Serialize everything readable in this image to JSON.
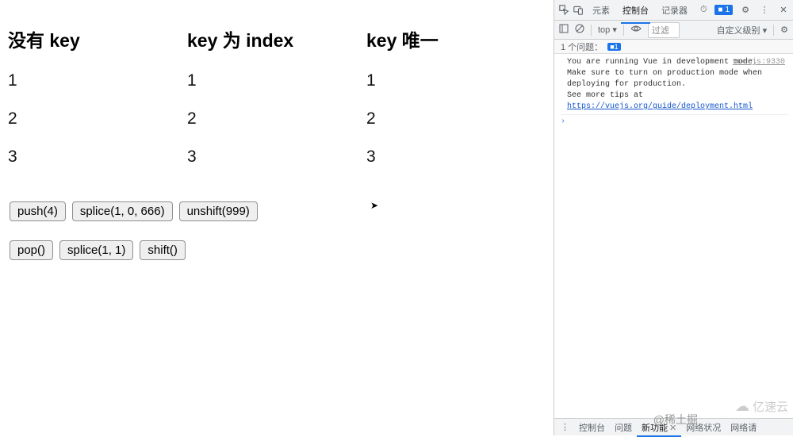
{
  "page": {
    "col1": {
      "heading": "没有 key",
      "items": [
        "1",
        "2",
        "3"
      ]
    },
    "col2": {
      "heading": "key 为 index",
      "items": [
        "1",
        "2",
        "3"
      ]
    },
    "col3": {
      "heading": "key 唯一",
      "items": [
        "1",
        "2",
        "3"
      ]
    },
    "row1": {
      "btn1": "push(4)",
      "btn2": "splice(1, 0, 666)",
      "btn3": "unshift(999)"
    },
    "row2": {
      "btn1": "pop()",
      "btn2": "splice(1, 1)",
      "btn3": "shift()"
    }
  },
  "devtools": {
    "tabs": {
      "elements": "元素",
      "console": "控制台",
      "recorder": "记录器",
      "performance_glyph": "⏱"
    },
    "topright": {
      "badge_count": "1",
      "gear": "⚙",
      "dots": "⋮",
      "close": "✕"
    },
    "toolbar2": {
      "top": "top ▾",
      "filter_placeholder": "过滤",
      "levels": "自定义级别 ▾",
      "gear": "⚙"
    },
    "issues": {
      "label": "1 个问题：",
      "count": "1"
    },
    "console": {
      "msg_line1": "You are running Vue in development mode.",
      "msg_line2": "Make sure to turn on production mode when deploying for production.",
      "msg_line3_pre": "See more tips at ",
      "msg_link": "https://vuejs.org/guide/deployment.html",
      "src": "vue.js:9330",
      "prompt": "›"
    },
    "bottombar": {
      "dots": "⋮",
      "console": "控制台",
      "issues": "问题",
      "whatsnew": "新功能",
      "network": "网络状况",
      "network2": "网络请"
    }
  },
  "watermarks": {
    "w1": "@稀土掘",
    "w2": "亿速云"
  }
}
